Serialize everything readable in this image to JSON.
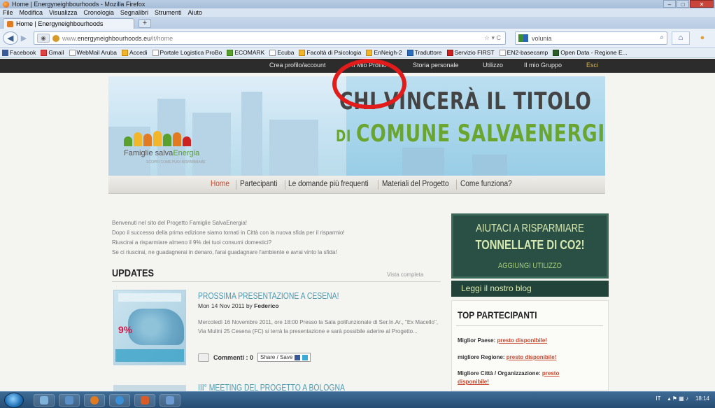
{
  "window": {
    "title": "Home | Energyneighbourhoods - Mozilla Firefox"
  },
  "menu": [
    "File",
    "Modifica",
    "Visualizza",
    "Cronologia",
    "Segnalibri",
    "Strumenti",
    "Aiuto"
  ],
  "tab": {
    "label": "Home | Energyneighbourhoods",
    "new_tab": "+"
  },
  "urlbar": {
    "prefix": "www.",
    "domain": "energyneighbourhoods.eu",
    "path": "/it/home"
  },
  "search": {
    "value": "volunia"
  },
  "bookmarks": [
    {
      "label": "Facebook",
      "icon": "fb"
    },
    {
      "label": "Gmail",
      "icon": "gm"
    },
    {
      "label": "WebMail Aruba",
      "icon": ""
    },
    {
      "label": "Accedi",
      "icon": "yl"
    },
    {
      "label": "Portale Logistica ProBo",
      "icon": ""
    },
    {
      "label": "ECOMARK",
      "icon": "gr"
    },
    {
      "label": "Ecuba",
      "icon": ""
    },
    {
      "label": "Facoltà di Psicologia",
      "icon": "yl"
    },
    {
      "label": "EnNeigh-2",
      "icon": "yl"
    },
    {
      "label": "Traduttore",
      "icon": "bl"
    },
    {
      "label": "Servizio FIRST",
      "icon": "rd"
    },
    {
      "label": "EN2-basecamp",
      "icon": ""
    },
    {
      "label": "Open Data - Regione E...",
      "icon": "dg"
    }
  ],
  "site_nav": {
    "items": [
      "Crea profilo/account",
      "Il Mio Profilo",
      "Storia personale",
      "Utilizzo",
      "Il mio Gruppo",
      "Esci"
    ]
  },
  "banner": {
    "logo_name_a": "Famiglie salva",
    "logo_name_b": "Energia",
    "logo_tag": "SCOPRI COME PUOI RISPARMIARE",
    "headline_1": "CHI VINCERÀ IL TITOLO",
    "headline_2a": "DI ",
    "headline_2b": "COMUNE SALVAENERGIA?"
  },
  "main_nav": [
    "Home",
    "Partecipanti",
    "Le domande più frequenti",
    "Materiali del Progetto",
    "Come funziona?"
  ],
  "intro": [
    "Benvenuti nel sito del Progetto Famiglie SalvaEnergia!",
    "Dopo il successo della prima edizione siamo tornati in Città con la nuova sfida per il risparmio!",
    "Riuscirai a risparmiare almeno il 9% dei tuoi consumi domestici?",
    "Se ci riuscirai, ne guadagnerai in denaro, farai guadagnare l'ambiente e avrai vinto la sfida!"
  ],
  "updates": {
    "heading": "UPDATES",
    "view_all": "Vista completa",
    "post": {
      "title": "PROSSIMA PRESENTAZIONE A CESENA!",
      "date": "Mon 14 Nov 2011 by ",
      "author": "Federico",
      "body": "Mercoledì 16 Novembre 2011, ore 18:00 Presso la Sala polifunzionale di Ser.In.Ar., \"Ex Macello\", Via Mulini 25 Cesena (FC) si terrà la presentazione e sarà possibile aderire al Progetto...",
      "comments": "Commenti : 0",
      "share": "Share / Save",
      "thumb_pct": "9%"
    },
    "post2_title": "III° MEETING DEL PROGETTO A BOLOGNA"
  },
  "sidebar": {
    "cta_line1": "AIUTACI A RISPARMIARE",
    "cta_line2": "TONNELLATE DI CO2!",
    "cta_action": "AGGIUNGI UTILIZZO",
    "blog": "Leggi il nostro blog",
    "top_heading": "TOP PARTECIPANTI",
    "rows": [
      {
        "label": "Miglior Paese: ",
        "value": "presto disponibile!"
      },
      {
        "label": "migliore Regione: ",
        "value": "presto disponibile!"
      },
      {
        "label": "Migliore Città / Organizzazione: ",
        "value": "presto"
      },
      {
        "label": "",
        "value": "disponibile!"
      }
    ]
  },
  "taskbar": {
    "lang": "IT",
    "time": "18:14"
  }
}
